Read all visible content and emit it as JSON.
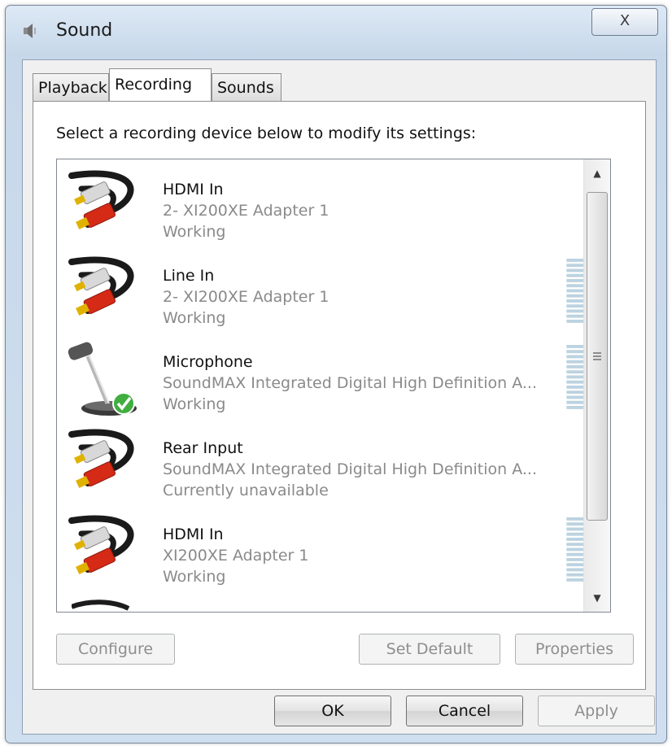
{
  "window": {
    "title": "Sound",
    "close_label": "X"
  },
  "tabs": [
    {
      "label": "Playback",
      "active": false
    },
    {
      "label": "Recording",
      "active": true
    },
    {
      "label": "Sounds",
      "active": false
    }
  ],
  "panel": {
    "instruction": "Select a recording device below to modify its settings:"
  },
  "devices": [
    {
      "name": "HDMI In",
      "description": "2- XI200XE Adapter 1",
      "status": "Working",
      "icon": "rca-cable-icon",
      "default": false,
      "meter": false
    },
    {
      "name": "Line In",
      "description": "2- XI200XE Adapter 1",
      "status": "Working",
      "icon": "rca-cable-icon",
      "default": false,
      "meter": true
    },
    {
      "name": "Microphone",
      "description": "SoundMAX Integrated Digital High Definition A...",
      "status": "Working",
      "icon": "microphone-icon",
      "default": true,
      "meter": true
    },
    {
      "name": "Rear Input",
      "description": "SoundMAX Integrated Digital High Definition A...",
      "status": "Currently unavailable",
      "icon": "rca-cable-icon",
      "default": false,
      "meter": false
    },
    {
      "name": "HDMI In",
      "description": "XI200XE Adapter 1",
      "status": "Working",
      "icon": "rca-cable-icon",
      "default": false,
      "meter": true
    }
  ],
  "buttons": {
    "configure": "Configure",
    "set_default": "Set Default",
    "properties": "Properties",
    "ok": "OK",
    "cancel": "Cancel",
    "apply": "Apply"
  },
  "colors": {
    "title_bar": "#c7d8ea",
    "meter": "#bcd3e0",
    "check_green": "#3fae3f"
  }
}
